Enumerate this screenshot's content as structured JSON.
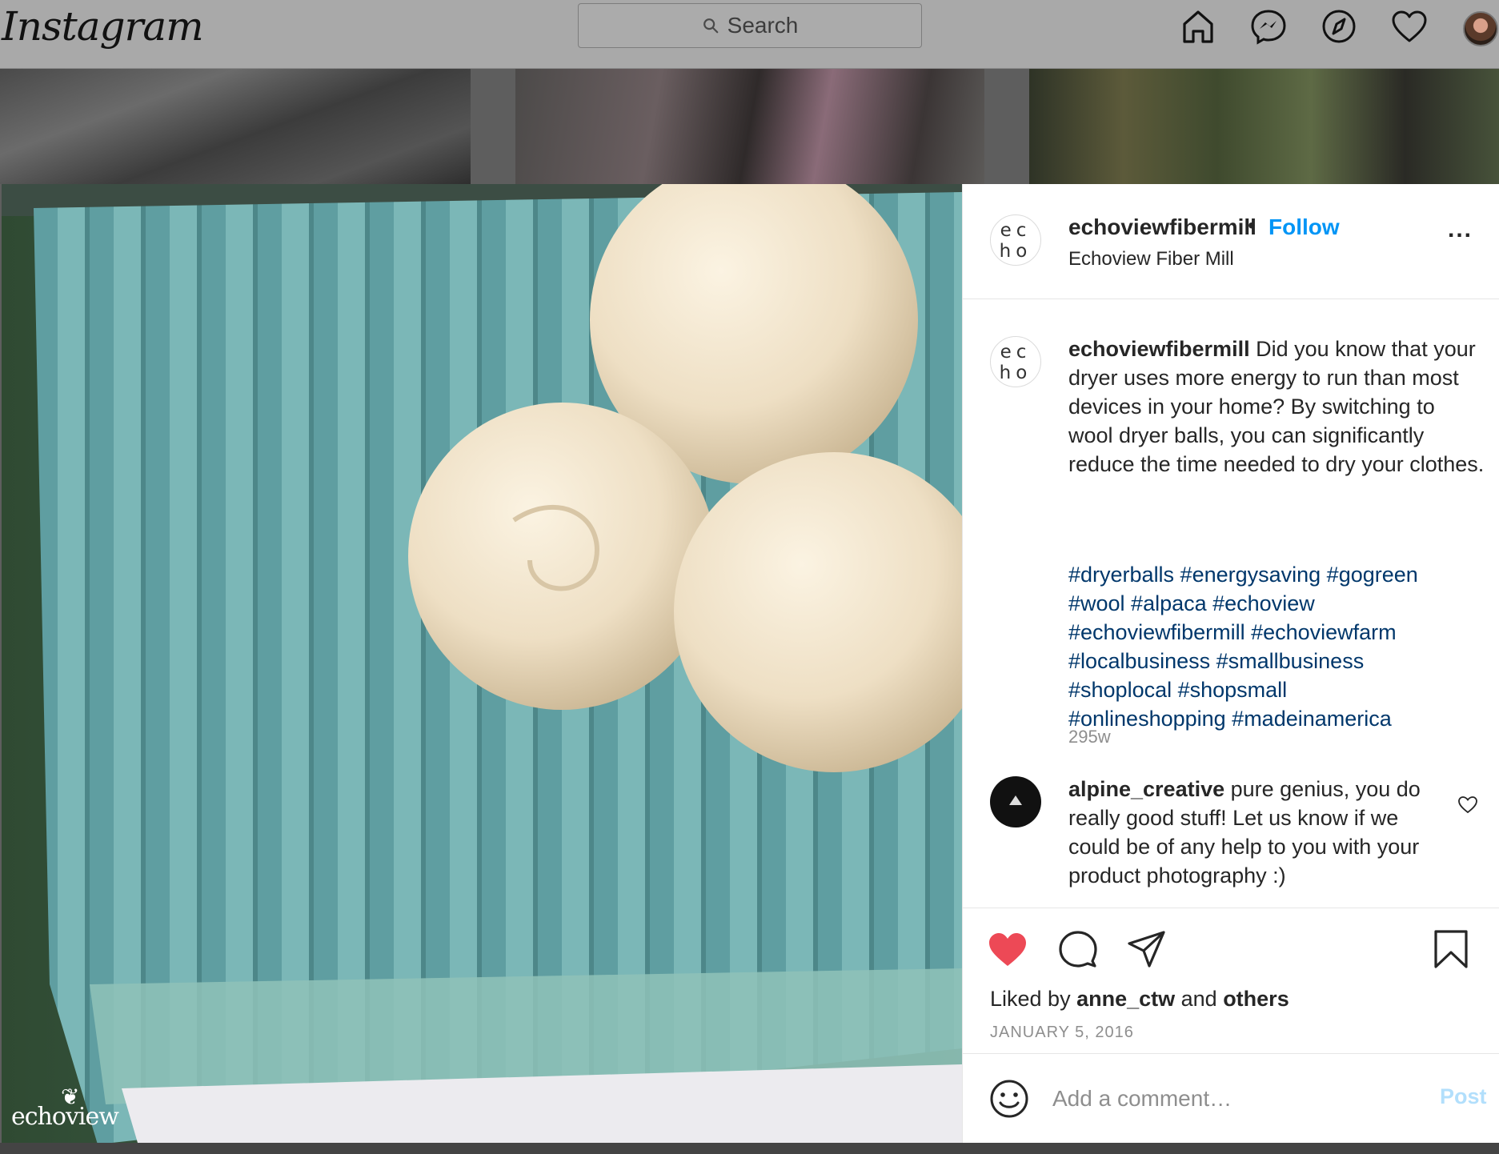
{
  "nav": {
    "logo": "Instagram",
    "search_placeholder": "Search",
    "icons": [
      "home-icon",
      "messenger-icon",
      "explore-icon",
      "heart-icon",
      "profile-avatar"
    ]
  },
  "post": {
    "username": "echoviewfibermill",
    "follow_label": "Follow",
    "bullet": "•",
    "location": "Echoview Fiber Mill",
    "more_label": "...",
    "avatar_text_line1": "ec",
    "avatar_text_line2": "ho",
    "caption_user": "echoviewfibermill",
    "caption_body": " Did you know that your dryer uses more energy to run than most devices in your home? By switching to wool dryer balls, you can significantly reduce the time needed to dry your clothes.",
    "hashtags": [
      "#dryerballs",
      "#energysaving",
      "#gogreen",
      "#wool",
      "#alpaca",
      "#echoview",
      "#echoviewfibermill",
      "#echoviewfarm",
      "#localbusiness",
      "#smallbusiness",
      "#shoplocal",
      "#shopsmall",
      "#onlineshopping",
      "#madeinamerica"
    ],
    "hashtag_lines": [
      "#dryerballs #energysaving #gogreen",
      "#wool #alpaca #echoview",
      "#echoviewfibermill #echoviewfarm",
      "#localbusiness #smallbusiness",
      "#shoplocal #shopsmall",
      "#onlineshopping #madeinamerica"
    ],
    "age": "295w",
    "comment": {
      "user": "alpine_creative",
      "text": " pure genius, you do really good stuff! Let us know if we could be of any help to you with your product photography :)"
    },
    "liked_prefix": "Liked by ",
    "liked_user": "anne_ctw",
    "liked_mid": " and ",
    "liked_others": "others",
    "date": "JANUARY 5, 2016",
    "add_comment_placeholder": "Add a comment…",
    "post_label": "Post",
    "watermark": "echoview",
    "liked": true
  },
  "colors": {
    "link_blue": "#0095f6",
    "hashtag": "#00376b",
    "like_red": "#ed4956",
    "post_disabled": "#b2dffc",
    "muted": "#8e8e8e"
  }
}
